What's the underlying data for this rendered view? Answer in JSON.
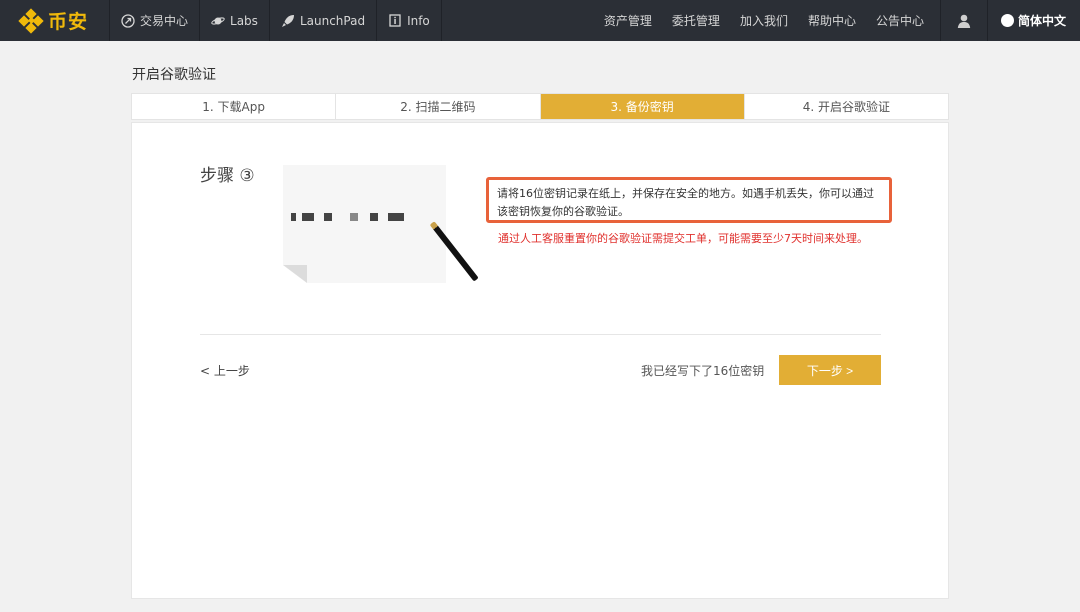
{
  "nav": {
    "brand": "币安",
    "items": [
      {
        "label": "交易中心",
        "icon": "exchange-icon"
      },
      {
        "label": "Labs",
        "icon": "planet-icon"
      },
      {
        "label": "LaunchPad",
        "icon": "rocket-icon"
      },
      {
        "label": "Info",
        "icon": "info-icon"
      }
    ],
    "right_items": [
      "资产管理",
      "委托管理",
      "加入我们",
      "帮助中心",
      "公告中心"
    ],
    "user_icon": "user-icon",
    "language": "简体中文"
  },
  "page": {
    "title": "开启谷歌验证"
  },
  "steps": [
    {
      "label": "1. 下载App",
      "active": false
    },
    {
      "label": "2. 扫描二维码",
      "active": false
    },
    {
      "label": "3. 备份密钥",
      "active": true
    },
    {
      "label": "4. 开启谷歌验证",
      "active": false
    }
  ],
  "content": {
    "step_label": "步骤 ③",
    "hint": "请将16位密钥记录在纸上，并保存在安全的地方。如遇手机丢失，你可以通过该密钥恢复你的谷歌验证。",
    "warning": "通过人工客服重置你的谷歌验证需提交工单，可能需要至少7天时间来处理。",
    "prev_label": "< 上一步",
    "confirm_text": "我已经写下了16位密钥",
    "next_label": "下一步 >"
  },
  "colors": {
    "nav_bg": "#2b2f36",
    "brand": "#f0b90b",
    "accent": "#e2ae35",
    "highlight_border": "#e8623a",
    "warning_text": "#e0312e"
  }
}
